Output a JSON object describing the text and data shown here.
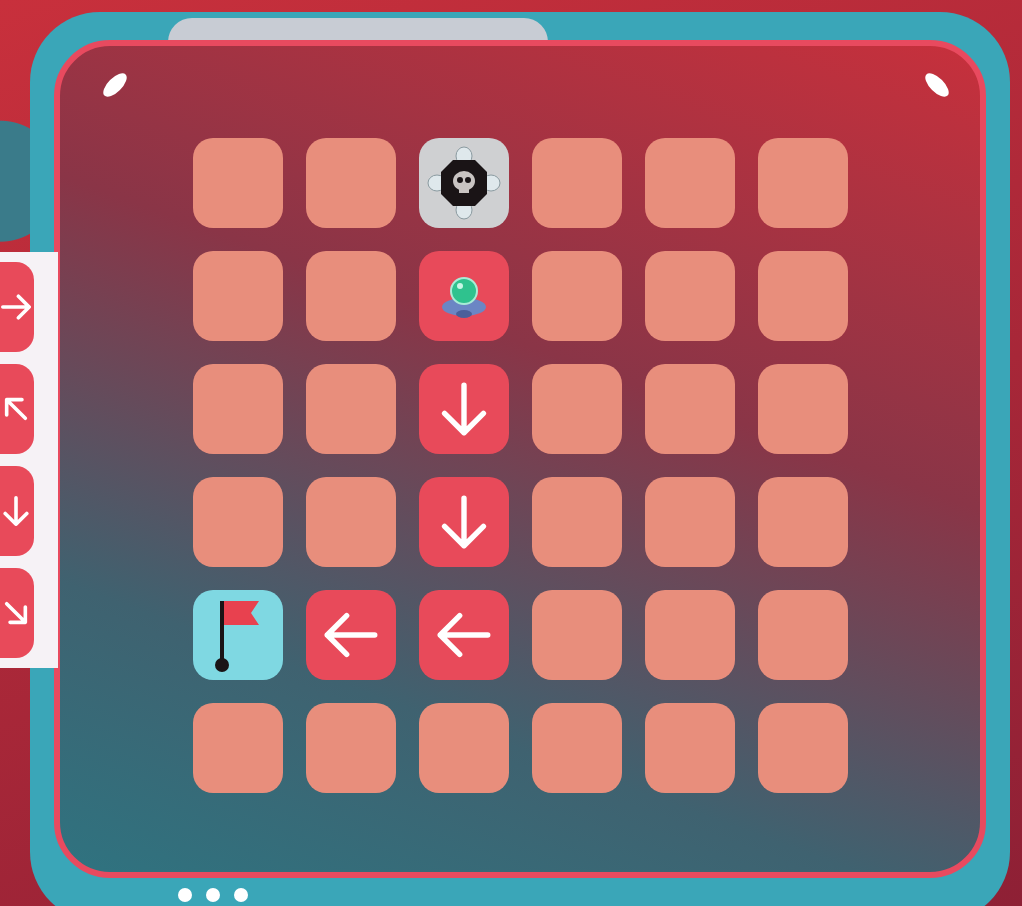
{
  "palette": [
    {
      "kind": "arrow-right"
    },
    {
      "kind": "arrow-up-left"
    },
    {
      "kind": "arrow-down"
    },
    {
      "kind": "arrow-down-right"
    }
  ],
  "grid": [
    [
      {
        "kind": "empty"
      },
      {
        "kind": "empty"
      },
      {
        "kind": "bomb"
      },
      {
        "kind": "empty"
      },
      {
        "kind": "empty"
      },
      {
        "kind": "empty"
      }
    ],
    [
      {
        "kind": "empty"
      },
      {
        "kind": "empty"
      },
      {
        "kind": "robot"
      },
      {
        "kind": "empty"
      },
      {
        "kind": "empty"
      },
      {
        "kind": "empty"
      }
    ],
    [
      {
        "kind": "empty"
      },
      {
        "kind": "empty"
      },
      {
        "kind": "arrow-down"
      },
      {
        "kind": "empty"
      },
      {
        "kind": "empty"
      },
      {
        "kind": "empty"
      }
    ],
    [
      {
        "kind": "empty"
      },
      {
        "kind": "empty"
      },
      {
        "kind": "arrow-down"
      },
      {
        "kind": "empty"
      },
      {
        "kind": "empty"
      },
      {
        "kind": "empty"
      }
    ],
    [
      {
        "kind": "goal"
      },
      {
        "kind": "arrow-left"
      },
      {
        "kind": "arrow-left"
      },
      {
        "kind": "empty"
      },
      {
        "kind": "empty"
      },
      {
        "kind": "empty"
      }
    ],
    [
      {
        "kind": "empty"
      },
      {
        "kind": "empty"
      },
      {
        "kind": "empty"
      },
      {
        "kind": "empty"
      },
      {
        "kind": "empty"
      },
      {
        "kind": "empty"
      }
    ]
  ]
}
